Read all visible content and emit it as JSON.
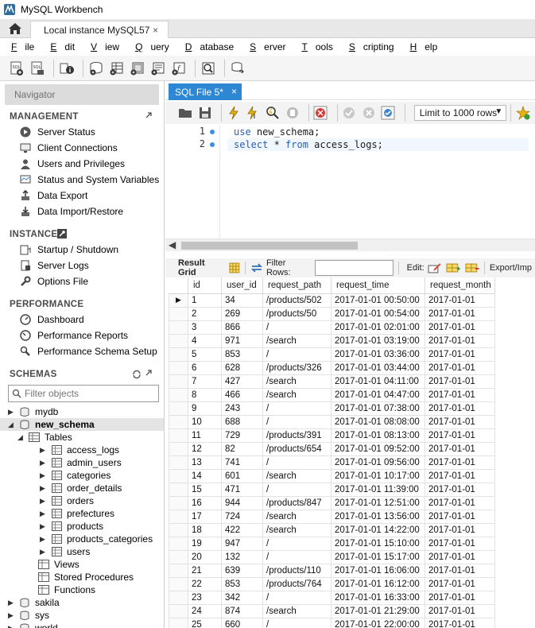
{
  "window": {
    "title": "MySQL Workbench"
  },
  "connection_tab": {
    "label": "Local instance MySQL57",
    "close": "×"
  },
  "menu": [
    {
      "label": "File",
      "u": "F",
      "rest": "ile"
    },
    {
      "label": "Edit",
      "u": "E",
      "rest": "dit"
    },
    {
      "label": "View",
      "u": "V",
      "rest": "iew"
    },
    {
      "label": "Query",
      "u": "Q",
      "rest": "uery"
    },
    {
      "label": "Database",
      "u": "D",
      "rest": "atabase"
    },
    {
      "label": "Server",
      "u": "S",
      "rest": "erver"
    },
    {
      "label": "Tools",
      "u": "T",
      "rest": "ools"
    },
    {
      "label": "Scripting",
      "u": "S",
      "rest": "cripting"
    },
    {
      "label": "Help",
      "u": "H",
      "rest": "elp"
    }
  ],
  "navigator": {
    "header": "Navigator",
    "management": {
      "title": "MANAGEMENT",
      "items": [
        "Server Status",
        "Client Connections",
        "Users and Privileges",
        "Status and System Variables",
        "Data Export",
        "Data Import/Restore"
      ]
    },
    "instance": {
      "title": "INSTANCE",
      "items": [
        "Startup / Shutdown",
        "Server Logs",
        "Options File"
      ]
    },
    "performance": {
      "title": "PERFORMANCE",
      "items": [
        "Dashboard",
        "Performance Reports",
        "Performance Schema Setup"
      ]
    },
    "schemas": {
      "title": "SCHEMAS",
      "filter_placeholder": "Filter objects",
      "before": [
        "mydb"
      ],
      "active_schema": "new_schema",
      "tables_label": "Tables",
      "tables": [
        "access_logs",
        "admin_users",
        "categories",
        "order_details",
        "orders",
        "prefectures",
        "products",
        "products_categories",
        "users"
      ],
      "views_label": "Views",
      "procs_label": "Stored Procedures",
      "funcs_label": "Functions",
      "after": [
        "sakila",
        "sys",
        "world"
      ]
    }
  },
  "editor": {
    "tab_label": "SQL File 5*",
    "tab_close": "×",
    "limit_label": "Limit to 1000 rows",
    "lines": [
      {
        "num": "1",
        "kw": "use",
        "rest": " new_schema;"
      },
      {
        "num": "2",
        "kw": "select",
        "mid": " * ",
        "kw2": "from",
        "rest": " access_logs;"
      }
    ]
  },
  "results": {
    "result_grid_label": "Result Grid",
    "filter_rows_label": "Filter Rows:",
    "edit_label": "Edit:",
    "export_label": "Export/Imp",
    "columns": [
      "id",
      "user_id",
      "request_path",
      "request_time",
      "request_month"
    ],
    "rows": [
      [
        "1",
        "34",
        "/products/502",
        "2017-01-01 00:50:00",
        "2017-01-01"
      ],
      [
        "2",
        "269",
        "/products/50",
        "2017-01-01 00:54:00",
        "2017-01-01"
      ],
      [
        "3",
        "866",
        "/",
        "2017-01-01 02:01:00",
        "2017-01-01"
      ],
      [
        "4",
        "971",
        "/search",
        "2017-01-01 03:19:00",
        "2017-01-01"
      ],
      [
        "5",
        "853",
        "/",
        "2017-01-01 03:36:00",
        "2017-01-01"
      ],
      [
        "6",
        "628",
        "/products/326",
        "2017-01-01 03:44:00",
        "2017-01-01"
      ],
      [
        "7",
        "427",
        "/search",
        "2017-01-01 04:11:00",
        "2017-01-01"
      ],
      [
        "8",
        "466",
        "/search",
        "2017-01-01 04:47:00",
        "2017-01-01"
      ],
      [
        "9",
        "243",
        "/",
        "2017-01-01 07:38:00",
        "2017-01-01"
      ],
      [
        "10",
        "688",
        "/",
        "2017-01-01 08:08:00",
        "2017-01-01"
      ],
      [
        "11",
        "729",
        "/products/391",
        "2017-01-01 08:13:00",
        "2017-01-01"
      ],
      [
        "12",
        "82",
        "/products/654",
        "2017-01-01 09:52:00",
        "2017-01-01"
      ],
      [
        "13",
        "741",
        "/",
        "2017-01-01 09:56:00",
        "2017-01-01"
      ],
      [
        "14",
        "601",
        "/search",
        "2017-01-01 10:17:00",
        "2017-01-01"
      ],
      [
        "15",
        "471",
        "/",
        "2017-01-01 11:39:00",
        "2017-01-01"
      ],
      [
        "16",
        "944",
        "/products/847",
        "2017-01-01 12:51:00",
        "2017-01-01"
      ],
      [
        "17",
        "724",
        "/search",
        "2017-01-01 13:56:00",
        "2017-01-01"
      ],
      [
        "18",
        "422",
        "/search",
        "2017-01-01 14:22:00",
        "2017-01-01"
      ],
      [
        "19",
        "947",
        "/",
        "2017-01-01 15:10:00",
        "2017-01-01"
      ],
      [
        "20",
        "132",
        "/",
        "2017-01-01 15:17:00",
        "2017-01-01"
      ],
      [
        "21",
        "639",
        "/products/110",
        "2017-01-01 16:06:00",
        "2017-01-01"
      ],
      [
        "22",
        "853",
        "/products/764",
        "2017-01-01 16:12:00",
        "2017-01-01"
      ],
      [
        "23",
        "342",
        "/",
        "2017-01-01 16:33:00",
        "2017-01-01"
      ],
      [
        "24",
        "874",
        "/search",
        "2017-01-01 21:29:00",
        "2017-01-01"
      ],
      [
        "25",
        "660",
        "/",
        "2017-01-01 22:00:00",
        "2017-01-01"
      ]
    ]
  },
  "colors": {
    "accent": "#2d87d2",
    "keyword": "#2a5db0",
    "nav_header_bg": "#dcdcdc"
  }
}
